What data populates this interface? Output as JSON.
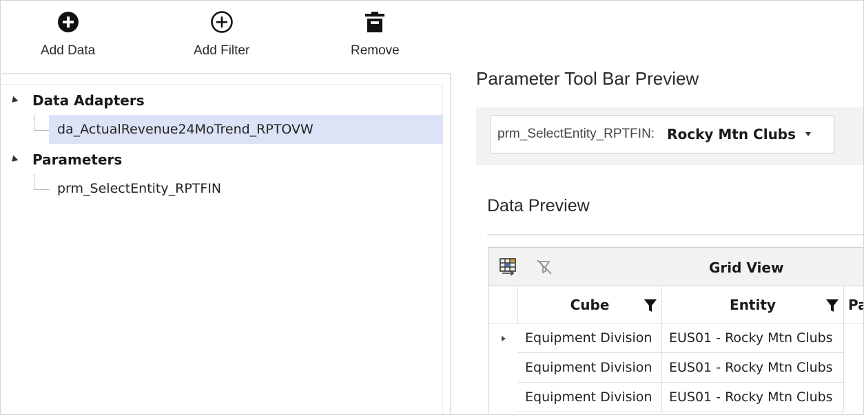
{
  "toolbar": {
    "add_data_label": "Add Data",
    "add_filter_label": "Add Filter",
    "remove_label": "Remove"
  },
  "tree": {
    "groups": [
      {
        "label": "Data Adapters",
        "items": [
          {
            "label": "da_ActualRevenue24MoTrend_RPTOVW",
            "selected": true
          }
        ]
      },
      {
        "label": "Parameters",
        "items": [
          {
            "label": "prm_SelectEntity_RPTFIN",
            "selected": false
          }
        ]
      }
    ]
  },
  "parameter_toolbar": {
    "title": "Parameter Tool Bar Preview",
    "param_label": "prm_SelectEntity_RPTFIN:",
    "param_value": "Rocky Mtn Clubs"
  },
  "data_preview": {
    "title": "Data Preview",
    "grid_title": "Grid View",
    "columns": [
      "Cube",
      "Entity",
      "Pa"
    ],
    "rows": [
      [
        "Equipment Division",
        "EUS01 - Rocky Mtn Clubs"
      ],
      [
        "Equipment Division",
        "EUS01 - Rocky Mtn Clubs"
      ],
      [
        "Equipment Division",
        "EUS01 - Rocky Mtn Clubs"
      ]
    ]
  },
  "colors": {
    "selection": "#dde3f7",
    "header_band": "#f2f2f2"
  }
}
